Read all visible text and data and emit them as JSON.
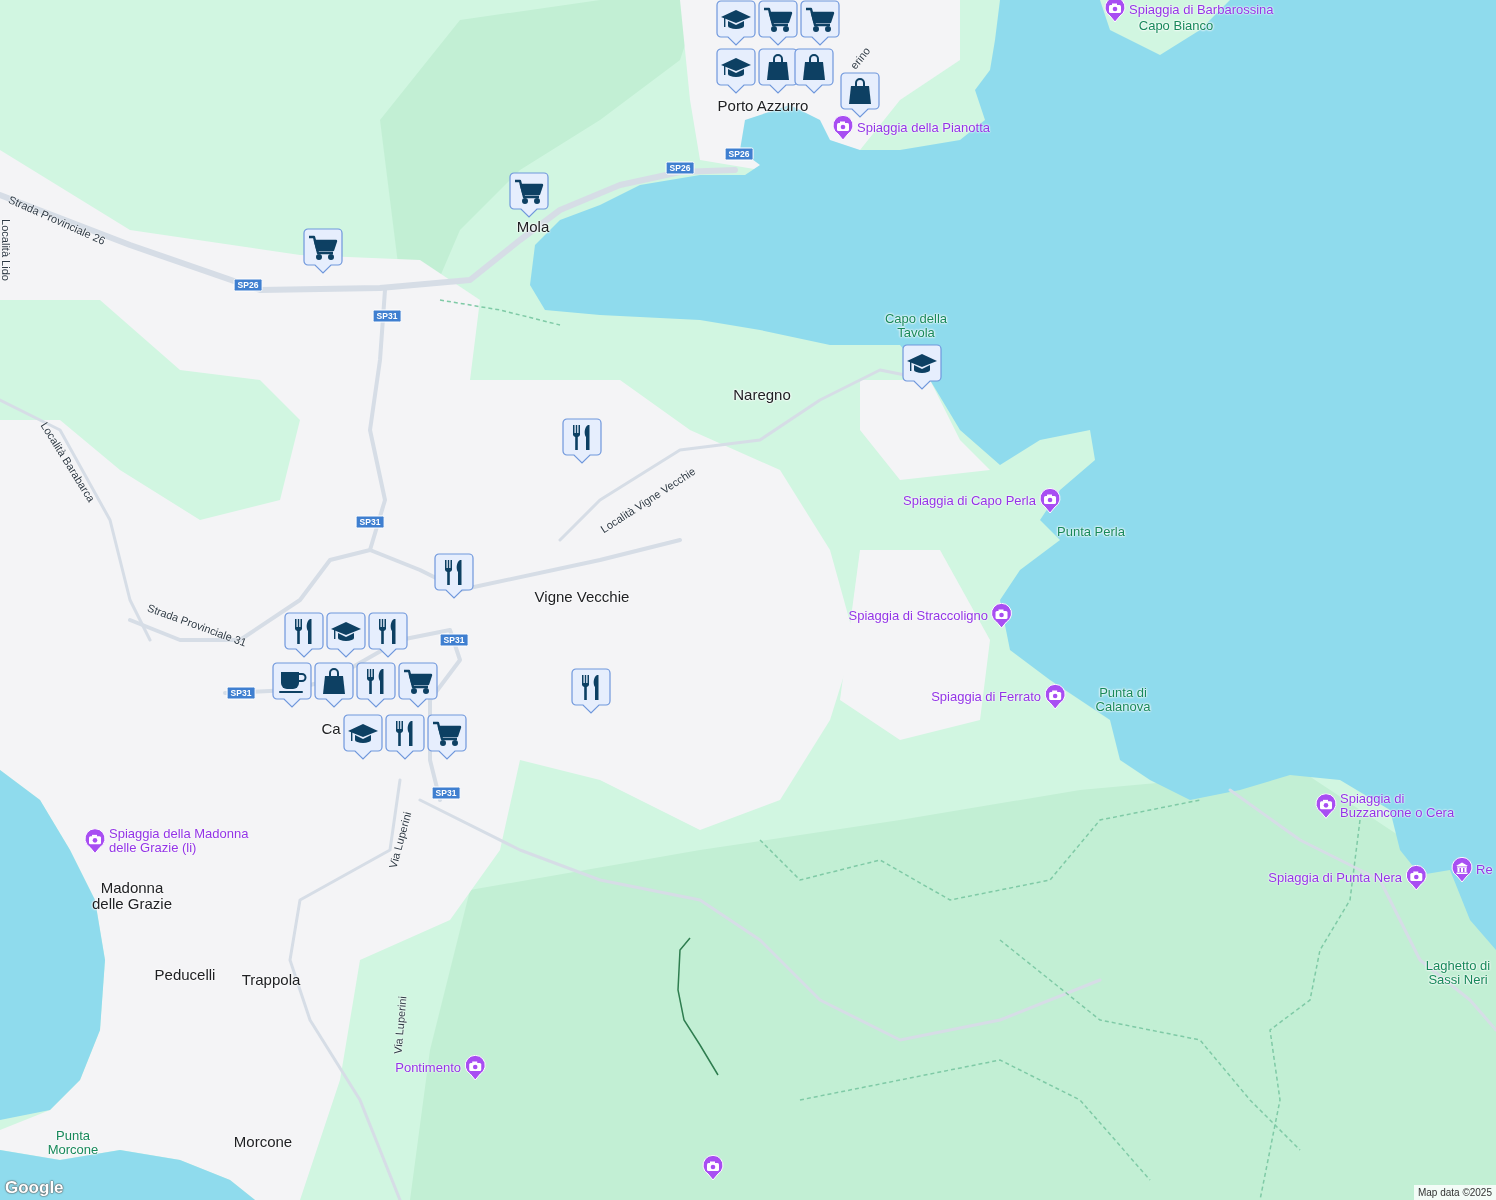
{
  "map": {
    "towns": [
      "Porto Azzurro",
      "Mola",
      "Naregno",
      "Vigne Vecchie",
      "Ca",
      "Madonna\ndelle Grazie",
      "Peducelli",
      "Trappola",
      "Morcone"
    ],
    "natural_features": [
      "Capo Bianco",
      "Capo della\nTavola",
      "Punta Perla",
      "Punta di\nCalanova",
      "Punta\nMorcone",
      "Laghetto di\nSassi Neri"
    ],
    "points_of_interest": [
      {
        "kind": "camera",
        "name": "Spiaggia di Barbarossina"
      },
      {
        "kind": "camera",
        "name": "Spiaggia della Pianotta"
      },
      {
        "kind": "camera",
        "name": "Spiaggia di Capo Perla"
      },
      {
        "kind": "camera",
        "name": "Spiaggia di Straccoligno"
      },
      {
        "kind": "camera",
        "name": "Spiaggia di Ferrato"
      },
      {
        "kind": "camera",
        "name": "Spiaggia di\nBuzzancone o Cera"
      },
      {
        "kind": "camera",
        "name": "Spiaggia di Punta Nera"
      },
      {
        "kind": "museum",
        "name": "Re"
      },
      {
        "kind": "camera",
        "name": "Spiaggia della Madonna\ndelle Grazie (li)"
      },
      {
        "kind": "camera",
        "name": "Pontimento"
      },
      {
        "kind": "camera"
      }
    ],
    "roads": [
      "Strada Provinciale 26",
      "Località Lido",
      "Località Barabarca",
      "Località Vigne Vecchie",
      "Strada Provinciale 31",
      "Via Luperini",
      "Via Luperini",
      "erino"
    ],
    "road_shields": [
      "SP26",
      "SP26",
      "SP26",
      "SP31",
      "SP31",
      "SP31",
      "SP31",
      "SP31"
    ],
    "markers": [
      {
        "kind": "school"
      },
      {
        "kind": "cart"
      },
      {
        "kind": "cart"
      },
      {
        "kind": "school"
      },
      {
        "kind": "bag"
      },
      {
        "kind": "bag"
      },
      {
        "kind": "bag"
      },
      {
        "kind": "cart"
      },
      {
        "kind": "cart"
      },
      {
        "kind": "school"
      },
      {
        "kind": "restaurant"
      },
      {
        "kind": "restaurant"
      },
      {
        "kind": "restaurant"
      },
      {
        "kind": "restaurant"
      },
      {
        "kind": "school"
      },
      {
        "kind": "restaurant"
      },
      {
        "kind": "cafe"
      },
      {
        "kind": "bag"
      },
      {
        "kind": "restaurant"
      },
      {
        "kind": "cart"
      },
      {
        "kind": "school"
      },
      {
        "kind": "restaurant"
      },
      {
        "kind": "cart"
      }
    ]
  },
  "footer": {
    "logo": "Google",
    "attribution": "Map data ©2025"
  }
}
